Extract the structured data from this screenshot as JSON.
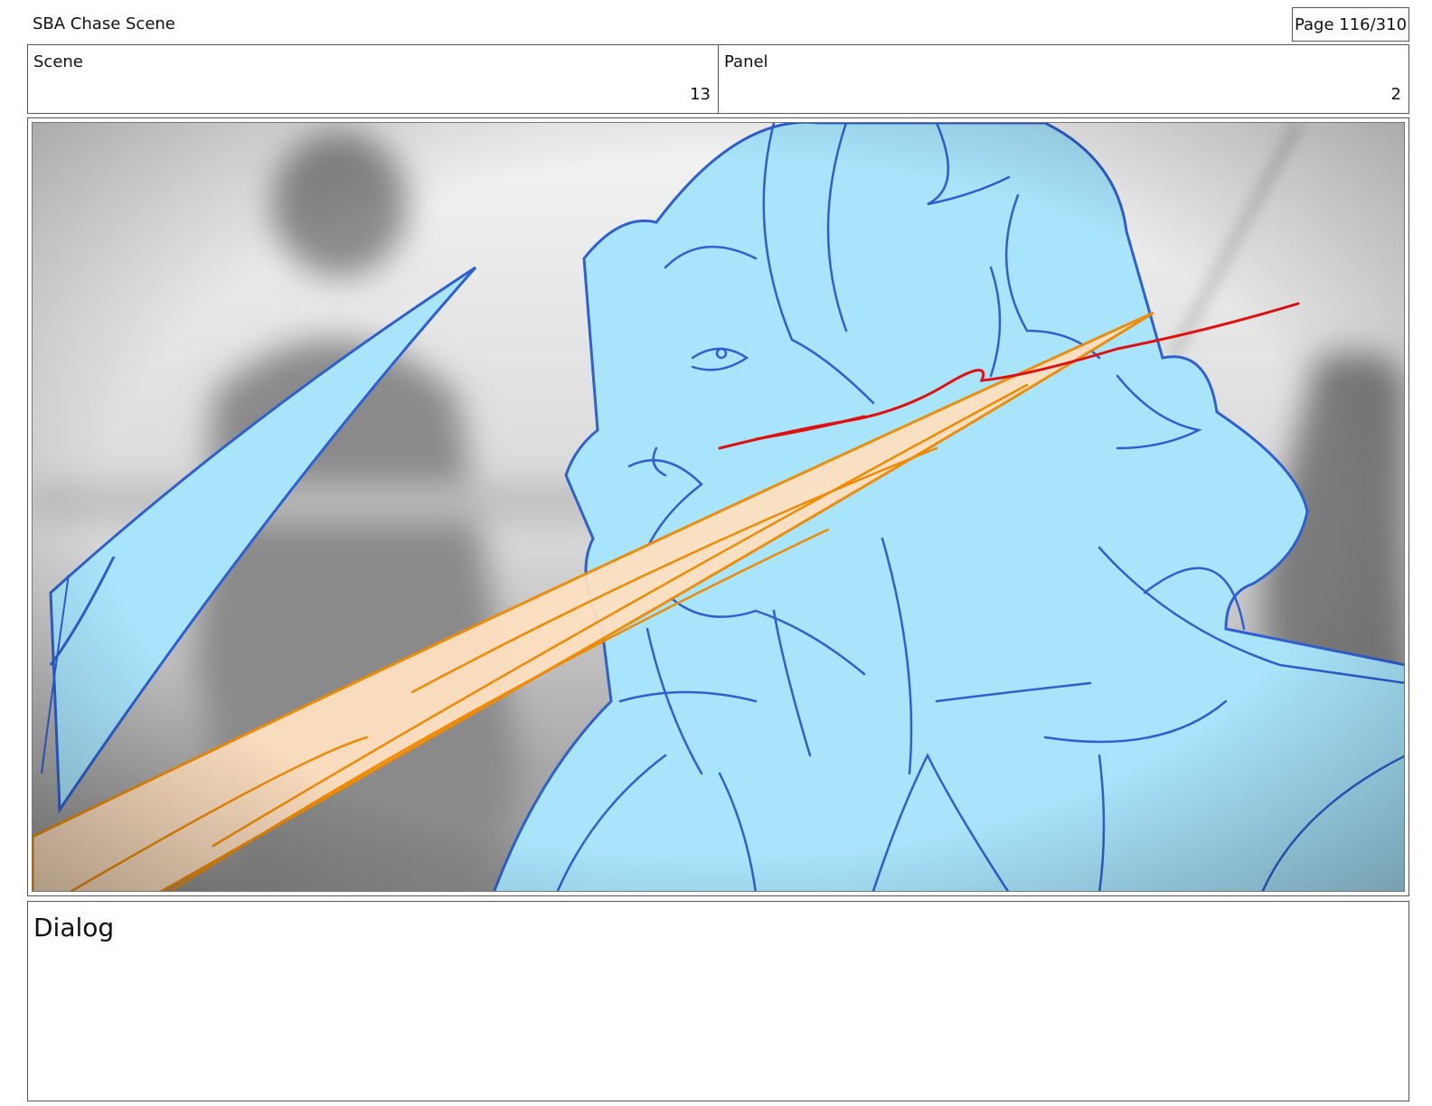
{
  "header": {
    "title": "SBA Chase Scene",
    "page": "Page 116/310"
  },
  "meta": {
    "scene_label": "Scene",
    "scene_value": "13",
    "panel_label": "Panel",
    "panel_value": "2"
  },
  "panel_image": {
    "description_icon": "storyboard-sketch-icon",
    "colors": {
      "background_light": "#f2f2f2",
      "background_dark": "#9a9a9a",
      "character_fill": "#a8e4fb",
      "character_line": "#2f5fd0",
      "streak_fill": "#ffe0c0",
      "streak_line": "#f08a00",
      "accent_red": "#e01010"
    }
  },
  "dialog": {
    "label": "Dialog",
    "text": ""
  }
}
